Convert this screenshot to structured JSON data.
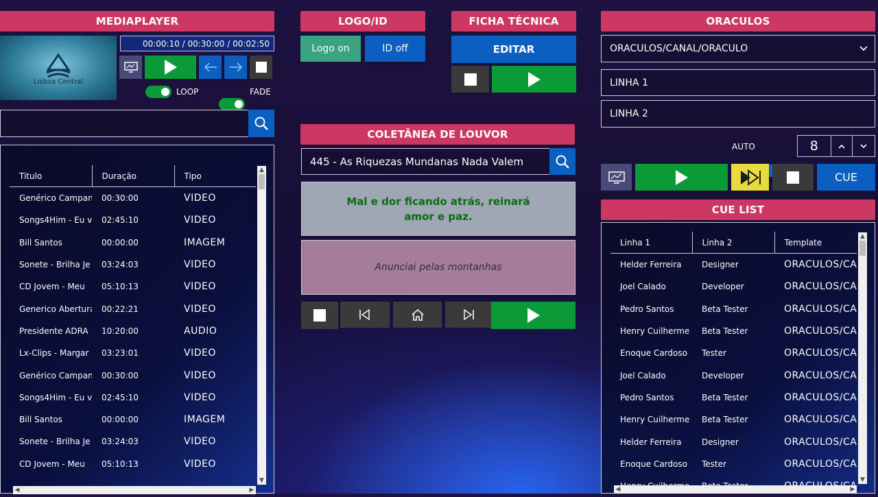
{
  "colors": {
    "header_bg": "#cc3763",
    "green": "#0a9a37",
    "blue": "#0a5fc0",
    "teal": "#3aa482",
    "yellow": "#e8db3b",
    "dark": "#3a3a3a"
  },
  "mediaplayer": {
    "header": "MEDIAPLAYER",
    "thumbnail_title": "Lisboa Central",
    "timecode": "00:00:10 / 00:30:00 / 00:02:50",
    "loop_label": "LOOP",
    "fade_label": "FADE",
    "loop_on": true,
    "fade_on": true,
    "search_value": "",
    "columns": [
      "Titulo",
      "Duração",
      "Tipo"
    ],
    "rows": [
      [
        "Genérico Campan",
        "00:30:00",
        "VIDEO"
      ],
      [
        "Songs4Him - Eu v",
        "02:45:10",
        "VIDEO"
      ],
      [
        "Bill Santos",
        "00:00:00",
        "IMAGEM"
      ],
      [
        "Sonete - Brilha Je",
        "03:24:03",
        "VIDEO"
      ],
      [
        "CD Jovem - Meu",
        "05:10:13",
        "VIDEO"
      ],
      [
        "Generico Abertura",
        "00:22:21",
        "VIDEO"
      ],
      [
        "Presidente ADRA",
        "10:20:00",
        "AUDIO"
      ],
      [
        "Lx-Clips - Margar",
        "03:23:01",
        "VIDEO"
      ],
      [
        "Genérico Campan",
        "00:30:00",
        "VIDEO"
      ],
      [
        "Songs4Him - Eu v",
        "02:45:10",
        "VIDEO"
      ],
      [
        "Bill Santos",
        "00:00:00",
        "IMAGEM"
      ],
      [
        "Sonete - Brilha Je",
        "03:24:03",
        "VIDEO"
      ],
      [
        "CD Jovem - Meu",
        "05:10:13",
        "VIDEO"
      ]
    ]
  },
  "logo": {
    "header": "LOGO/ID",
    "logo_on": "Logo on",
    "id_off": "ID off"
  },
  "ficha": {
    "header": "FICHA TÉCNICA",
    "edit": "EDITAR"
  },
  "coletanea": {
    "header": "COLETÂNEA DE LOUVOR",
    "search_value": "445 - As Riquezas Mundanas Nada Valem",
    "current_line": "Mal e dor ficando atrás, reinará amor e paz.",
    "next_line": "Anunciai pelas montanhas"
  },
  "oraculos": {
    "header": "ORACULOS",
    "template_select": "ORACULOS/CANAL/ORACULO",
    "linha1": "LINHA 1",
    "linha2": "LINHA 2",
    "auto_label": "AUTO",
    "auto_on": true,
    "counter": "8",
    "cue_label": "CUE"
  },
  "cuelist": {
    "header": "CUE LIST",
    "columns": [
      "Linha 1",
      "Linha 2",
      "Template"
    ],
    "rows": [
      [
        "Helder Ferreira",
        "Designer",
        "ORACULOS/CA"
      ],
      [
        "Joel Calado",
        "Developer",
        "ORACULOS/CA"
      ],
      [
        "Pedro Santos",
        "Beta Tester",
        "ORACULOS/CA"
      ],
      [
        "Henry Cuilherme",
        "Beta Tester",
        "ORACULOS/CA"
      ],
      [
        "Enoque Cardoso",
        "Tester",
        "ORACULOS/CA"
      ],
      [
        "Joel Calado",
        "Developer",
        "ORACULOS/CA"
      ],
      [
        "Pedro Santos",
        "Beta Tester",
        "ORACULOS/CA"
      ],
      [
        "Henry Cuilherme",
        "Beta Tester",
        "ORACULOS/CA"
      ],
      [
        "Helder Ferreira",
        "Designer",
        "ORACULOS/CA"
      ],
      [
        "Enoque Cardoso",
        "Tester",
        "ORACULOS/CA"
      ],
      [
        "Henry Cuilherme",
        "Beta Tester",
        "ORACULOS/CA"
      ]
    ]
  },
  "icons": {
    "play": "play-icon",
    "stop": "stop-icon",
    "prev": "arrow-left-icon",
    "next": "arrow-right-icon",
    "screen": "screen-icon",
    "search": "search-icon",
    "skip_back": "skip-back-icon",
    "home": "home-icon",
    "skip_forward": "skip-forward-icon",
    "fast_forward": "fast-forward-icon",
    "chevron_down": "chevron-down-icon",
    "chevron_up": "chevron-up-icon"
  }
}
